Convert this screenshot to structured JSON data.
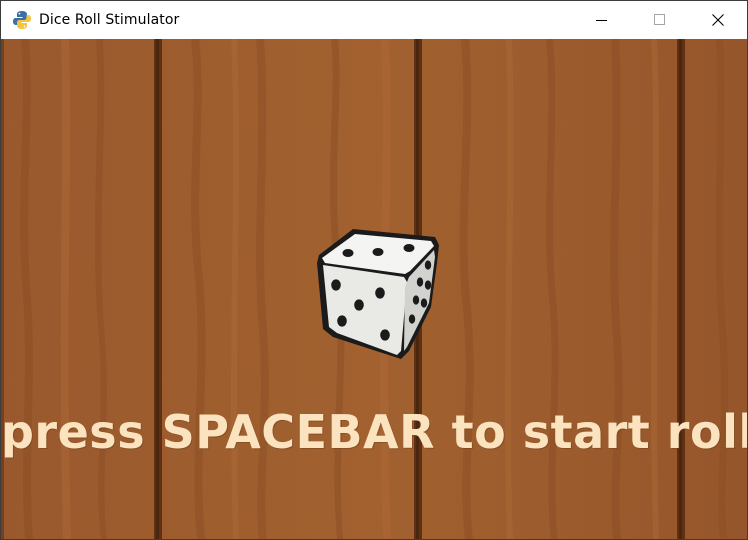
{
  "window": {
    "title": "Dice Roll Stimulator",
    "app_icon": "python-icon",
    "controls": {
      "minimize": "minimize-icon",
      "maximize": "maximize-icon",
      "close": "close-icon"
    }
  },
  "game": {
    "background": "wood-plank-background",
    "dice_icon": "dice-icon",
    "prompt": "press SPACEBAR to start rolling"
  },
  "colors": {
    "wood": "#9c5b2f",
    "wood_dark": "#6e3c1d",
    "prompt_text": "#fbe3bf",
    "titlebar": "#ffffff"
  }
}
